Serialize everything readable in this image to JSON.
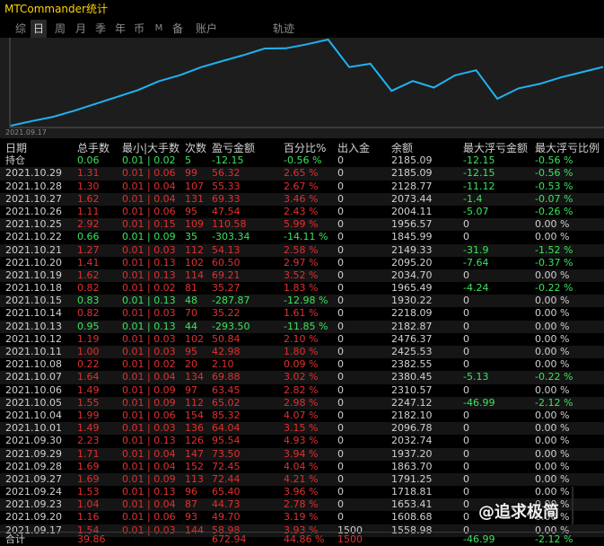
{
  "window": {
    "title": "MTCommander统计"
  },
  "tabs": [
    {
      "label": "综",
      "active": false
    },
    {
      "label": "日",
      "active": true
    },
    {
      "label": "周",
      "active": false
    },
    {
      "label": "月",
      "active": false
    },
    {
      "label": "季",
      "active": false
    },
    {
      "label": "年",
      "active": false
    },
    {
      "label": "币",
      "active": false
    },
    {
      "label": "M",
      "active": false
    },
    {
      "label": "备",
      "active": false
    },
    {
      "label": "账户",
      "active": false
    }
  ],
  "track_label": "轨迹",
  "chart": {
    "start_date": "2021.09.17",
    "line_color": "#1fb3f2"
  },
  "chart_data": {
    "type": "line",
    "series": [
      {
        "values": [
          1558.98,
          1608.68,
          1653.41,
          1718.81,
          1791.25,
          1863.7,
          1937.2,
          2032.74,
          2096.78,
          2182.1,
          2247.12,
          2310.57,
          2380.45,
          2382.55,
          2425.53,
          2476.37,
          2182.87,
          2218.09,
          1930.22,
          2034.7,
          1965.49,
          2095.2,
          2149.33,
          1845.99,
          1956.57,
          2004.11,
          2073.44,
          2128.77,
          2185.09
        ]
      }
    ]
  },
  "table": {
    "headers": [
      "日期",
      "总手数",
      "最小|大手数",
      "次数",
      "盈亏金额",
      "百分比%",
      "出入金",
      "余额",
      "最大浮亏金额",
      "最大浮亏比例"
    ],
    "holding": {
      "date": "持仓",
      "lots": "0.06",
      "minmax": "0.01 | 0.02",
      "count": "5",
      "pl": "-12.15",
      "pct": "-0.56 %",
      "io": "0",
      "bal": "2185.09",
      "mfl": "-12.15",
      "mfr": "-0.56 %",
      "color": "green"
    },
    "rows": [
      {
        "date": "2021.10.29",
        "lots": "1.31",
        "minmax": "0.01 | 0.06",
        "count": "99",
        "pl": "56.32",
        "pct": "2.65 %",
        "io": "0",
        "bal": "2185.09",
        "mfl": "-12.15",
        "mfr": "-0.56 %",
        "color": "red"
      },
      {
        "date": "2021.10.28",
        "lots": "1.30",
        "minmax": "0.01 | 0.04",
        "count": "107",
        "pl": "55.33",
        "pct": "2.67 %",
        "io": "0",
        "bal": "2128.77",
        "mfl": "-11.12",
        "mfr": "-0.53 %",
        "color": "red"
      },
      {
        "date": "2021.10.27",
        "lots": "1.62",
        "minmax": "0.01 | 0.04",
        "count": "131",
        "pl": "69.33",
        "pct": "3.46 %",
        "io": "0",
        "bal": "2073.44",
        "mfl": "-1.4",
        "mfr": "-0.07 %",
        "color": "red"
      },
      {
        "date": "2021.10.26",
        "lots": "1.11",
        "minmax": "0.01 | 0.06",
        "count": "95",
        "pl": "47.54",
        "pct": "2.43 %",
        "io": "0",
        "bal": "2004.11",
        "mfl": "-5.07",
        "mfr": "-0.26 %",
        "color": "red"
      },
      {
        "date": "2021.10.25",
        "lots": "2.92",
        "minmax": "0.01 | 0.15",
        "count": "109",
        "pl": "110.58",
        "pct": "5.99 %",
        "io": "0",
        "bal": "1956.57",
        "mfl": "0",
        "mfr": "0.00 %",
        "color": "red"
      },
      {
        "date": "2021.10.22",
        "lots": "0.66",
        "minmax": "0.01 | 0.09",
        "count": "35",
        "pl": "-303.34",
        "pct": "-14.11 %",
        "io": "0",
        "bal": "1845.99",
        "mfl": "0",
        "mfr": "0.00 %",
        "color": "green"
      },
      {
        "date": "2021.10.21",
        "lots": "1.27",
        "minmax": "0.01 | 0.03",
        "count": "112",
        "pl": "54.13",
        "pct": "2.58 %",
        "io": "0",
        "bal": "2149.33",
        "mfl": "-31.9",
        "mfr": "-1.52 %",
        "color": "red"
      },
      {
        "date": "2021.10.20",
        "lots": "1.41",
        "minmax": "0.01 | 0.13",
        "count": "102",
        "pl": "60.50",
        "pct": "2.97 %",
        "io": "0",
        "bal": "2095.20",
        "mfl": "-7.64",
        "mfr": "-0.37 %",
        "color": "red"
      },
      {
        "date": "2021.10.19",
        "lots": "1.62",
        "minmax": "0.01 | 0.13",
        "count": "114",
        "pl": "69.21",
        "pct": "3.52 %",
        "io": "0",
        "bal": "2034.70",
        "mfl": "0",
        "mfr": "0.00 %",
        "color": "red"
      },
      {
        "date": "2021.10.18",
        "lots": "0.82",
        "minmax": "0.01 | 0.02",
        "count": "81",
        "pl": "35.27",
        "pct": "1.83 %",
        "io": "0",
        "bal": "1965.49",
        "mfl": "-4.24",
        "mfr": "-0.22 %",
        "color": "red"
      },
      {
        "date": "2021.10.15",
        "lots": "0.83",
        "minmax": "0.01 | 0.13",
        "count": "48",
        "pl": "-287.87",
        "pct": "-12.98 %",
        "io": "0",
        "bal": "1930.22",
        "mfl": "0",
        "mfr": "0.00 %",
        "color": "green"
      },
      {
        "date": "2021.10.14",
        "lots": "0.82",
        "minmax": "0.01 | 0.03",
        "count": "70",
        "pl": "35.22",
        "pct": "1.61 %",
        "io": "0",
        "bal": "2218.09",
        "mfl": "0",
        "mfr": "0.00 %",
        "color": "red"
      },
      {
        "date": "2021.10.13",
        "lots": "0.95",
        "minmax": "0.01 | 0.13",
        "count": "44",
        "pl": "-293.50",
        "pct": "-11.85 %",
        "io": "0",
        "bal": "2182.87",
        "mfl": "0",
        "mfr": "0.00 %",
        "color": "green"
      },
      {
        "date": "2021.10.12",
        "lots": "1.19",
        "minmax": "0.01 | 0.03",
        "count": "102",
        "pl": "50.84",
        "pct": "2.10 %",
        "io": "0",
        "bal": "2476.37",
        "mfl": "0",
        "mfr": "0.00 %",
        "color": "red"
      },
      {
        "date": "2021.10.11",
        "lots": "1.00",
        "minmax": "0.01 | 0.03",
        "count": "95",
        "pl": "42.98",
        "pct": "1.80 %",
        "io": "0",
        "bal": "2425.53",
        "mfl": "0",
        "mfr": "0.00 %",
        "color": "red"
      },
      {
        "date": "2021.10.08",
        "lots": "0.22",
        "minmax": "0.01 | 0.02",
        "count": "20",
        "pl": "2.10",
        "pct": "0.09 %",
        "io": "0",
        "bal": "2382.55",
        "mfl": "0",
        "mfr": "0.00 %",
        "color": "red"
      },
      {
        "date": "2021.10.07",
        "lots": "1.64",
        "minmax": "0.01 | 0.04",
        "count": "134",
        "pl": "69.88",
        "pct": "3.02 %",
        "io": "0",
        "bal": "2380.45",
        "mfl": "-5.13",
        "mfr": "-0.22 %",
        "color": "red"
      },
      {
        "date": "2021.10.06",
        "lots": "1.49",
        "minmax": "0.01 | 0.09",
        "count": "97",
        "pl": "63.45",
        "pct": "2.82 %",
        "io": "0",
        "bal": "2310.57",
        "mfl": "0",
        "mfr": "0.00 %",
        "color": "red"
      },
      {
        "date": "2021.10.05",
        "lots": "1.55",
        "minmax": "0.01 | 0.09",
        "count": "112",
        "pl": "65.02",
        "pct": "2.98 %",
        "io": "0",
        "bal": "2247.12",
        "mfl": "-46.99",
        "mfr": "-2.12 %",
        "color": "red"
      },
      {
        "date": "2021.10.04",
        "lots": "1.99",
        "minmax": "0.01 | 0.06",
        "count": "154",
        "pl": "85.32",
        "pct": "4.07 %",
        "io": "0",
        "bal": "2182.10",
        "mfl": "0",
        "mfr": "0.00 %",
        "color": "red"
      },
      {
        "date": "2021.10.01",
        "lots": "1.49",
        "minmax": "0.01 | 0.03",
        "count": "136",
        "pl": "64.04",
        "pct": "3.15 %",
        "io": "0",
        "bal": "2096.78",
        "mfl": "0",
        "mfr": "0.00 %",
        "color": "red"
      },
      {
        "date": "2021.09.30",
        "lots": "2.23",
        "minmax": "0.01 | 0.13",
        "count": "126",
        "pl": "95.54",
        "pct": "4.93 %",
        "io": "0",
        "bal": "2032.74",
        "mfl": "0",
        "mfr": "0.00 %",
        "color": "red"
      },
      {
        "date": "2021.09.29",
        "lots": "1.71",
        "minmax": "0.01 | 0.04",
        "count": "147",
        "pl": "73.50",
        "pct": "3.94 %",
        "io": "0",
        "bal": "1937.20",
        "mfl": "0",
        "mfr": "0.00 %",
        "color": "red"
      },
      {
        "date": "2021.09.28",
        "lots": "1.69",
        "minmax": "0.01 | 0.04",
        "count": "152",
        "pl": "72.45",
        "pct": "4.04 %",
        "io": "0",
        "bal": "1863.70",
        "mfl": "0",
        "mfr": "0.00 %",
        "color": "red"
      },
      {
        "date": "2021.09.27",
        "lots": "1.69",
        "minmax": "0.01 | 0.09",
        "count": "113",
        "pl": "72.44",
        "pct": "4.21 %",
        "io": "0",
        "bal": "1791.25",
        "mfl": "0",
        "mfr": "0.00 %",
        "color": "red"
      },
      {
        "date": "2021.09.24",
        "lots": "1.53",
        "minmax": "0.01 | 0.13",
        "count": "96",
        "pl": "65.40",
        "pct": "3.96 %",
        "io": "0",
        "bal": "1718.81",
        "mfl": "0",
        "mfr": "0.00 %",
        "color": "red"
      },
      {
        "date": "2021.09.23",
        "lots": "1.04",
        "minmax": "0.01 | 0.04",
        "count": "87",
        "pl": "44.73",
        "pct": "2.78 %",
        "io": "0",
        "bal": "1653.41",
        "mfl": "0",
        "mfr": "0.00 %",
        "color": "red"
      },
      {
        "date": "2021.09.20",
        "lots": "1.16",
        "minmax": "0.01 | 0.06",
        "count": "93",
        "pl": "49.70",
        "pct": "3.19 %",
        "io": "0",
        "bal": "1608.68",
        "mfl": "0",
        "mfr": "0.00 %",
        "color": "red"
      },
      {
        "date": "2021.09.17",
        "lots": "1.54",
        "minmax": "0.01 | 0.03",
        "count": "144",
        "pl": "58.98",
        "pct": "3.93 %",
        "io": "1500",
        "bal": "1558.98",
        "mfl": "0",
        "mfr": "0.00 %",
        "color": "red"
      }
    ],
    "total": {
      "date": "合计",
      "lots": "39.86",
      "minmax": "",
      "count": "",
      "pl": "672.94",
      "pct": "44.86 %",
      "io": "1500",
      "bal": "",
      "mfl": "-46.99",
      "mfr": "-2.12 %"
    }
  },
  "watermark": "@追求极简",
  "colors": {
    "gain": "#e03030",
    "loss": "#3ce35c",
    "title": "#ffd400",
    "line": "#1fb3f2"
  }
}
